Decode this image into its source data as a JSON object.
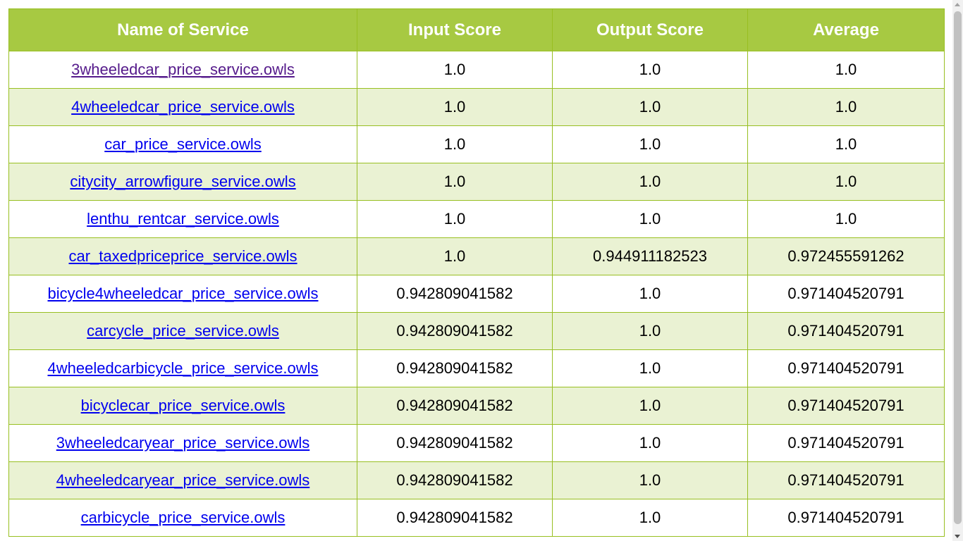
{
  "table": {
    "headers": [
      "Name of Service",
      "Input Score",
      "Output Score",
      "Average"
    ],
    "rows": [
      {
        "name": "3wheeledcar_price_service.owls",
        "input": "1.0",
        "output": "1.0",
        "average": "1.0"
      },
      {
        "name": "4wheeledcar_price_service.owls",
        "input": "1.0",
        "output": "1.0",
        "average": "1.0"
      },
      {
        "name": "car_price_service.owls",
        "input": "1.0",
        "output": "1.0",
        "average": "1.0"
      },
      {
        "name": "citycity_arrowfigure_service.owls",
        "input": "1.0",
        "output": "1.0",
        "average": "1.0"
      },
      {
        "name": "lenthu_rentcar_service.owls",
        "input": "1.0",
        "output": "1.0",
        "average": "1.0"
      },
      {
        "name": "car_taxedpriceprice_service.owls",
        "input": "1.0",
        "output": "0.944911182523",
        "average": "0.972455591262"
      },
      {
        "name": "bicycle4wheeledcar_price_service.owls",
        "input": "0.942809041582",
        "output": "1.0",
        "average": "0.971404520791"
      },
      {
        "name": "carcycle_price_service.owls",
        "input": "0.942809041582",
        "output": "1.0",
        "average": "0.971404520791"
      },
      {
        "name": "4wheeledcarbicycle_price_service.owls",
        "input": "0.942809041582",
        "output": "1.0",
        "average": "0.971404520791"
      },
      {
        "name": "bicyclecar_price_service.owls",
        "input": "0.942809041582",
        "output": "1.0",
        "average": "0.971404520791"
      },
      {
        "name": "3wheeledcaryear_price_service.owls",
        "input": "0.942809041582",
        "output": "1.0",
        "average": "0.971404520791"
      },
      {
        "name": "4wheeledcaryear_price_service.owls",
        "input": "0.942809041582",
        "output": "1.0",
        "average": "0.971404520791"
      },
      {
        "name": "carbicycle_price_service.owls",
        "input": "0.942809041582",
        "output": "1.0",
        "average": "0.971404520791"
      }
    ]
  },
  "colors": {
    "header_bg": "#a7c942",
    "header_text": "#ffffff",
    "border": "#98bf21",
    "alt_row_bg": "#eaf2d3",
    "link": "#0000ee",
    "visited_link": "#551a8b"
  }
}
